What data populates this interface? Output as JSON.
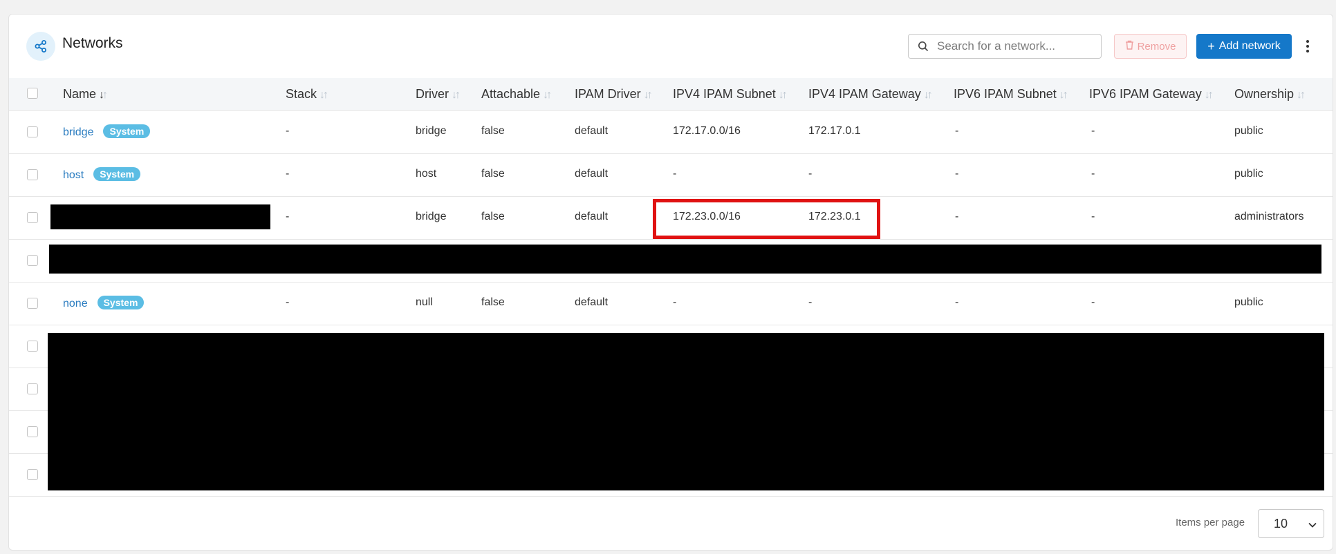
{
  "header": {
    "title": "Networks",
    "search_placeholder": "Search for a network...",
    "remove_label": "Remove",
    "add_label": "Add network"
  },
  "columns": [
    "Name",
    "Stack",
    "Driver",
    "Attachable",
    "IPAM Driver",
    "IPV4 IPAM Subnet",
    "IPV4 IPAM Gateway",
    "IPV6 IPAM Subnet",
    "IPV6 IPAM Gateway",
    "Ownership"
  ],
  "rows": [
    {
      "name": "bridge",
      "badge": "System",
      "stack": "-",
      "driver": "bridge",
      "attachable": "false",
      "ipam_driver": "default",
      "ipv4_subnet": "172.17.0.0/16",
      "ipv4_gateway": "172.17.0.1",
      "ipv6_subnet": "-",
      "ipv6_gateway": "-",
      "ownership": "public"
    },
    {
      "name": "host",
      "badge": "System",
      "stack": "-",
      "driver": "host",
      "attachable": "false",
      "ipam_driver": "default",
      "ipv4_subnet": "-",
      "ipv4_gateway": "-",
      "ipv6_subnet": "-",
      "ipv6_gateway": "-",
      "ownership": "public"
    },
    {
      "name": "",
      "badge": "",
      "stack": "-",
      "driver": "bridge",
      "attachable": "false",
      "ipam_driver": "default",
      "ipv4_subnet": "172.23.0.0/16",
      "ipv4_gateway": "172.23.0.1",
      "ipv6_subnet": "-",
      "ipv6_gateway": "-",
      "ownership": "administrators"
    },
    {
      "name": "none",
      "badge": "System",
      "stack": "-",
      "driver": "null",
      "attachable": "false",
      "ipam_driver": "default",
      "ipv4_subnet": "-",
      "ipv4_gateway": "-",
      "ipv6_subnet": "-",
      "ipv6_gateway": "-",
      "ownership": "public"
    }
  ],
  "footer": {
    "items_per_page_label": "Items per page",
    "items_per_page_value": "10"
  },
  "colors": {
    "accent": "#1578c9",
    "badge": "#5bbde4",
    "highlight": "#e01212",
    "link": "#2a7cc0"
  }
}
